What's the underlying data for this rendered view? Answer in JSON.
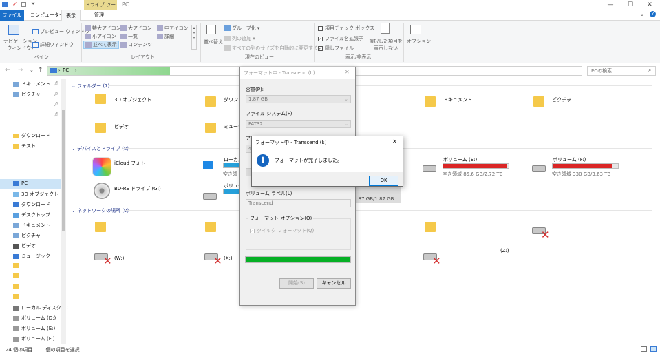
{
  "titlebar": {
    "context_tab": "ドライブ ツール",
    "title": "PC",
    "minimize": "—",
    "maximize": "☐",
    "close": "✕"
  },
  "tabs": {
    "file": "ファイル",
    "computer": "コンピューター",
    "view": "表示",
    "manage": "管理"
  },
  "ribbon": {
    "nav_pane": "ナビゲーション\nウィンドウ▾",
    "preview_pane": "プレビュー ウィンドウ",
    "details_pane": "詳細ウィンドウ",
    "group_pane": "ペイン",
    "layout": [
      "特大アイコン",
      "大アイコン",
      "中アイコン",
      "小アイコン",
      "一覧",
      "詳細",
      "並べて表示",
      "コンテンツ"
    ],
    "group_layout": "レイアウト",
    "sort": "並べ替え",
    "group_by": "グループ化 ▾",
    "add_column": "列の追加 ▾",
    "fit_columns": "すべての列のサイズを自動的に変更する",
    "group_current_view": "現在のビュー",
    "item_checkbox": "項目チェック ボックス",
    "file_ext": "ファイル名拡張子",
    "hidden_items": "隠しファイル",
    "hide_selected": "選択した項目を\n表示しない",
    "options": "オプション",
    "group_show_hide": "表示/非表示"
  },
  "address": {
    "path": "PC",
    "search_placeholder": "PCの検索"
  },
  "nav": {
    "items": [
      "ドキュメント",
      "ピクチャ",
      "ダウンロード",
      "テスト",
      "PC",
      "3D オブジェクト",
      "ダウンロード",
      "デスクトップ",
      "ドキュメント",
      "ピクチャ",
      "ビデオ",
      "ミュージック",
      "ローカル ディスク (C",
      "ボリューム (D:)",
      "ボリューム (E:)",
      "ボリューム (F:)"
    ]
  },
  "content": {
    "folders_header": "フォルダー (7)",
    "folders": [
      "3D オブジェクト",
      "ダウンロ",
      "ドキュメント",
      "ピクチャ",
      "ビデオ",
      "ミュージ"
    ],
    "devices_header": "デバイスとドライブ (8)",
    "icloud": "iCloud フォト",
    "local_disk": "ローカル",
    "local_free": "空き領",
    "volume_d": "ボリューム",
    "vol_e": {
      "name": "ボリューム (E:)",
      "free": "空き領域 85.6 GB/2.72 TB",
      "fill": 0.97
    },
    "vol_f": {
      "name": "ボリューム (F:)",
      "free": "空き領域 330 GB/3.63 TB",
      "fill": 0.91
    },
    "bdre": "BD-RE ドライブ (G:)",
    "transcend_free": "1.87 GB/1.87 GB",
    "network_header": "ネットワークの場所 (9)",
    "net_w": "(W:)",
    "net_x": "(X:)",
    "net_z": "(Z:)"
  },
  "status": {
    "count": "24 個の項目",
    "selected": "1 個の項目を選択"
  },
  "format_dialog": {
    "title": "フォーマット中 - Transcend (I:)",
    "capacity_label": "容量(P):",
    "capacity_value": "1.87 GB",
    "fs_label": "ファイル システム(F)",
    "fs_value": "FAT32",
    "alloc_label": "アロ",
    "alloc_value": "4C",
    "volume_label": "ボリューム ラベル(L)",
    "volume_value": "Transcend",
    "options_label": "フォーマット オプション(O)",
    "quick_format": "クイック フォーマット(Q)",
    "progress": 1.0,
    "start": "開始(S)",
    "cancel": "キャンセル"
  },
  "message": {
    "title": "フォーマット中 - Transcend (I:)",
    "text": "フォーマットが完了しました。",
    "ok": "OK",
    "info_glyph": "i",
    "close": "✕"
  }
}
